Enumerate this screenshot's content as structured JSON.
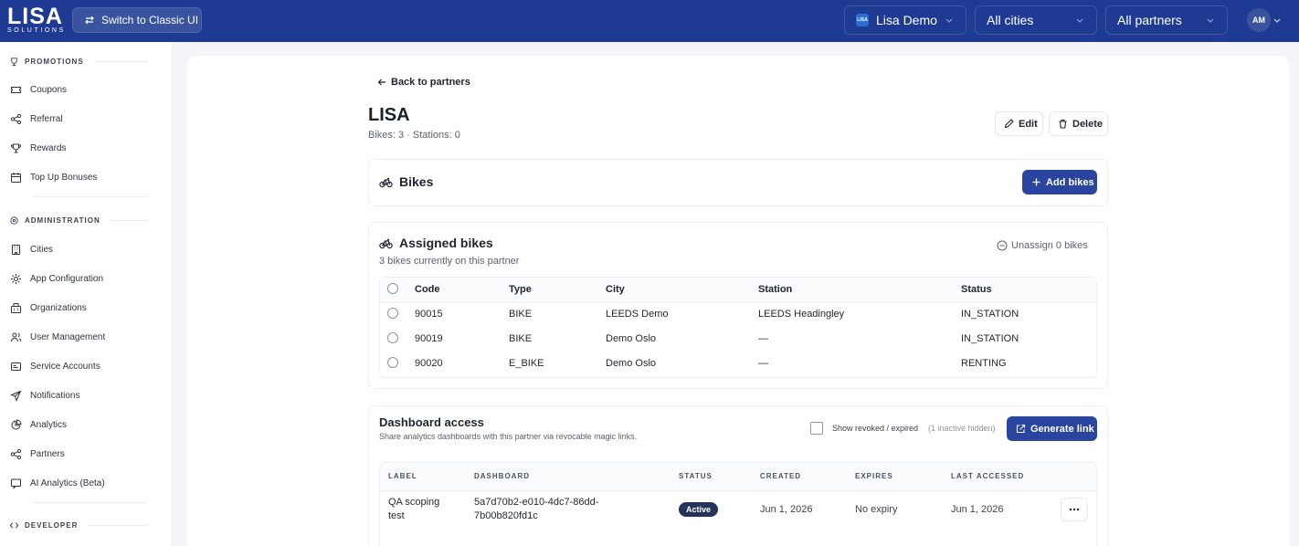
{
  "header": {
    "logo_main": "LISA",
    "logo_sub": "SOLUTIONS",
    "switch_label": "Switch to Classic UI",
    "org_badge": "LISA",
    "org_select": "Lisa Demo",
    "city_select": "All cities",
    "partner_select": "All partners",
    "avatar_initials": "AM"
  },
  "sidebar": {
    "sections": [
      {
        "title": "PROMOTIONS",
        "items": [
          "Coupons",
          "Referral",
          "Rewards",
          "Top Up Bonuses"
        ]
      },
      {
        "title": "ADMINISTRATION",
        "items": [
          "Cities",
          "App Configuration",
          "Organizations",
          "User Management",
          "Service Accounts",
          "Notifications",
          "Analytics",
          "Partners",
          "AI Analytics (Beta)"
        ]
      },
      {
        "title": "DEVELOPER",
        "items": []
      }
    ]
  },
  "page": {
    "back_label": "Back to partners",
    "title": "LISA",
    "subtitle": "Bikes: 3 · Stations: 0",
    "edit_label": "Edit",
    "delete_label": "Delete"
  },
  "bikes_panel": {
    "title": "Bikes",
    "add_label": "Add bikes"
  },
  "assigned": {
    "title": "Assigned bikes",
    "subtitle": "3 bikes currently on this partner",
    "unassign_label": "Unassign 0 bikes",
    "columns": [
      "Code",
      "Type",
      "City",
      "Station",
      "Status"
    ],
    "rows": [
      {
        "code": "90015",
        "type": "BIKE",
        "city": "LEEDS Demo",
        "station": "LEEDS Headingley",
        "status": "IN_STATION"
      },
      {
        "code": "90019",
        "type": "BIKE",
        "city": "Demo Oslo",
        "station": "—",
        "status": "IN_STATION"
      },
      {
        "code": "90020",
        "type": "E_BIKE",
        "city": "Demo Oslo",
        "station": "—",
        "status": "RENTING"
      }
    ]
  },
  "dashboard": {
    "title": "Dashboard access",
    "subtitle": "Share analytics dashboards with this partner via revocable magic links.",
    "show_revoked_label": "Show revoked / expired",
    "inactive_hidden": "(1 inactive hidden)",
    "generate_label": "Generate link",
    "columns": [
      "LABEL",
      "DASHBOARD",
      "STATUS",
      "CREATED",
      "EXPIRES",
      "LAST ACCESSED"
    ],
    "rows": [
      {
        "label_line1": "QA scoping",
        "label_line2": "test",
        "dashboard_line1": "5a7d70b2-e010-4dc7-86dd-",
        "dashboard_line2": "7b00b820fd1c",
        "status": "Active",
        "created": "Jun 1, 2026",
        "expires": "No expiry",
        "last_accessed": "Jun 1, 2026"
      }
    ]
  }
}
